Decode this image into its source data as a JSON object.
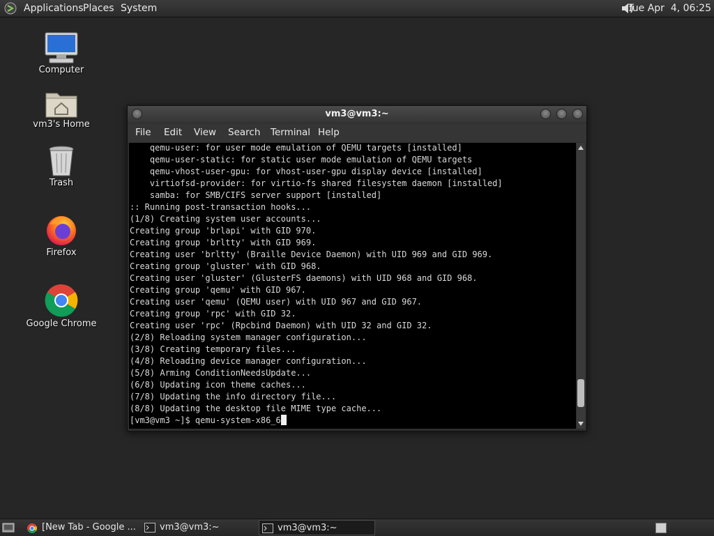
{
  "top_panel": {
    "menus": [
      "Applications",
      "Places",
      "System"
    ],
    "clock": "Tue Apr  4, 06:25",
    "speaker_icon": "volume-icon"
  },
  "desktop_icons": [
    {
      "label": "Computer",
      "icon": "computer-icon"
    },
    {
      "label": "vm3's Home",
      "icon": "home-folder-icon"
    },
    {
      "label": "Trash",
      "icon": "trash-icon"
    },
    {
      "label": "Firefox",
      "icon": "firefox-icon"
    },
    {
      "label": "Google Chrome",
      "icon": "chrome-icon"
    }
  ],
  "terminal": {
    "title": "vm3@vm3:~",
    "menu": [
      "File",
      "Edit",
      "View",
      "Search",
      "Terminal",
      "Help"
    ],
    "lines": [
      "    qemu-user: for user mode emulation of QEMU targets [installed]",
      "    qemu-user-static: for static user mode emulation of QEMU targets",
      "    qemu-vhost-user-gpu: for vhost-user-gpu display device [installed]",
      "    virtiofsd-provider: for virtio-fs shared filesystem daemon [installed]",
      "    samba: for SMB/CIFS server support [installed]",
      ":: Running post-transaction hooks...",
      "(1/8) Creating system user accounts...",
      "Creating group 'brlapi' with GID 970.",
      "Creating group 'brltty' with GID 969.",
      "Creating user 'brltty' (Braille Device Daemon) with UID 969 and GID 969.",
      "Creating group 'gluster' with GID 968.",
      "Creating user 'gluster' (GlusterFS daemons) with UID 968 and GID 968.",
      "Creating group 'qemu' with GID 967.",
      "Creating user 'qemu' (QEMU user) with UID 967 and GID 967.",
      "Creating group 'rpc' with GID 32.",
      "Creating user 'rpc' (Rpcbind Daemon) with UID 32 and GID 32.",
      "(2/8) Reloading system manager configuration...",
      "(3/8) Creating temporary files...",
      "(4/8) Reloading device manager configuration...",
      "(5/8) Arming ConditionNeedsUpdate...",
      "(6/8) Updating icon theme caches...",
      "(7/8) Updating the info directory file...",
      "(8/8) Updating the desktop file MIME type cache..."
    ],
    "prompt": "[vm3@vm3 ~]$ ",
    "input": "qemu-system-x86_6",
    "scroll_position": 0.95
  },
  "taskbar": {
    "tasks": [
      {
        "label": "[New Tab - Google ...",
        "icon": "chrome-icon",
        "active": false
      },
      {
        "label": "vm3@vm3:~",
        "icon": "terminal-icon",
        "active": false
      },
      {
        "label": "vm3@vm3:~",
        "icon": "terminal-icon",
        "active": true
      }
    ]
  }
}
